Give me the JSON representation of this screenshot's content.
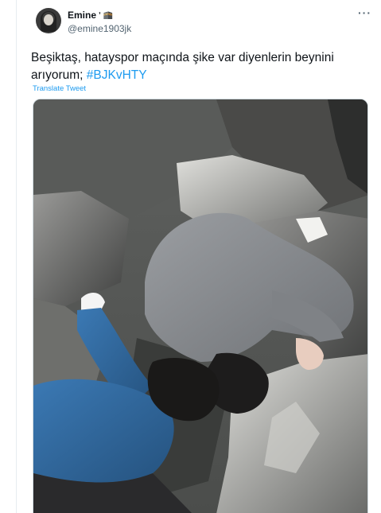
{
  "tweet": {
    "display_name": "Emine",
    "name_suffix": "ʼ 🕋",
    "handle": "@emine1903jk",
    "more_label": "···",
    "text_line": "Beşiktaş, hatayspor maçında şike var diyenlerin beynini arıyorum; ",
    "hashtag": "#BJKvHTY",
    "translate_label": "Translate Tweet"
  },
  "icons": {
    "more": "more-options-icon",
    "avatar": "user-avatar"
  },
  "colors": {
    "link": "#1d9bf0",
    "secondary_text": "#536471",
    "border": "#cfd9de"
  }
}
